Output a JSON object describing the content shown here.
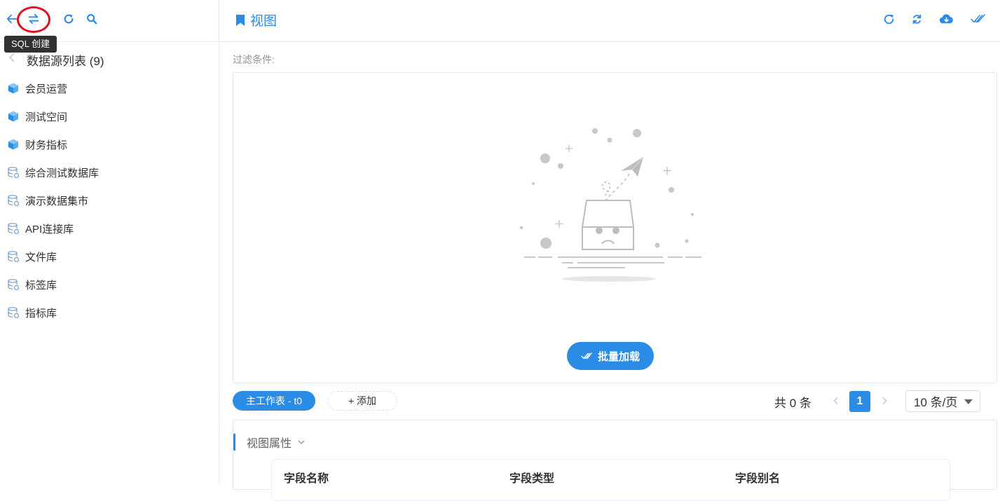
{
  "sidebar": {
    "tooltip": "SQL 创建",
    "toolbar": {
      "icons": [
        "arrow-left-icon",
        "swap-icon",
        "refresh-icon",
        "search-icon"
      ]
    },
    "datasource_header": "数据源列表 (9)",
    "items": [
      {
        "label": "会员运营",
        "icon": "cube-icon"
      },
      {
        "label": "测试空间",
        "icon": "cube-icon"
      },
      {
        "label": "财务指标",
        "icon": "cube-icon"
      },
      {
        "label": "综合测试数据库",
        "icon": "database-icon"
      },
      {
        "label": "演示数据集市",
        "icon": "database-icon"
      },
      {
        "label": "API连接库",
        "icon": "database-icon"
      },
      {
        "label": "文件库",
        "icon": "database-icon"
      },
      {
        "label": "标签库",
        "icon": "database-icon"
      },
      {
        "label": "指标库",
        "icon": "database-icon"
      }
    ]
  },
  "main": {
    "title": "视图",
    "header_icons": [
      "refresh-icon",
      "sync-icon",
      "cloud-download-icon",
      "double-check-icon"
    ],
    "filter_label": "过滤条件:",
    "batch_load_label": "批量加载",
    "tabs": {
      "main_tab": "主工作表 - t0",
      "add": "+ 添加"
    },
    "pagination": {
      "total": "共 0 条",
      "current_page": "1",
      "page_size": "10 条/页"
    },
    "properties": {
      "title": "视图属性",
      "columns": [
        "字段名称",
        "字段类型",
        "字段别名"
      ]
    }
  },
  "colors": {
    "accent": "#2b8ce6",
    "annotation": "#e0101c"
  }
}
